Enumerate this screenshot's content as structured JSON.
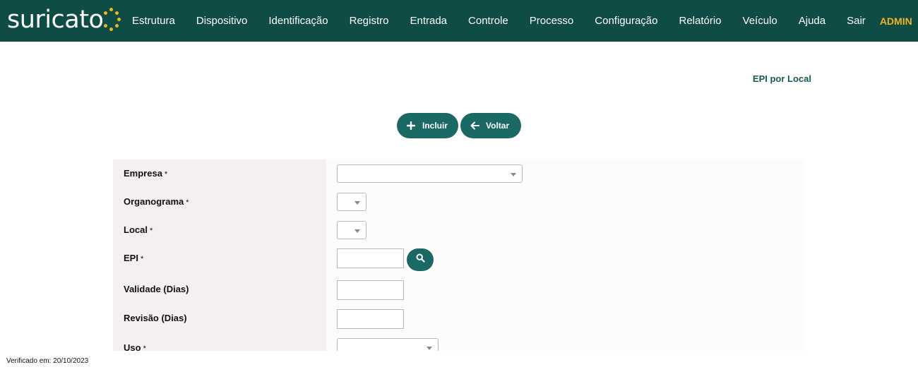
{
  "header": {
    "logo_text": "suricato",
    "nav": [
      "Estrutura",
      "Dispositivo",
      "Identificação",
      "Registro",
      "Entrada",
      "Controle",
      "Processo",
      "Configuração",
      "Relatório",
      "Veículo",
      "Ajuda",
      "Sair"
    ],
    "user": "ADMIN"
  },
  "page": {
    "title": "EPI por Local"
  },
  "actions": {
    "incluir": "Incluir",
    "voltar": "Voltar"
  },
  "form": {
    "required_mark": "*",
    "fields": {
      "empresa": "Empresa",
      "organograma": "Organograma",
      "local": "Local",
      "epi": "EPI",
      "validade": "Validade (Dias)",
      "revisao": "Revisão (Dias)",
      "uso": "Uso"
    }
  },
  "footer": {
    "verified": "Verificado em: 20/10/2023"
  },
  "colors": {
    "header_bg": "#0e4c45",
    "accent": "#1a6965",
    "admin": "#f0b323"
  },
  "icons": [
    "plus-icon",
    "arrow-left-icon",
    "search-icon",
    "dropdown-caret-icon"
  ]
}
